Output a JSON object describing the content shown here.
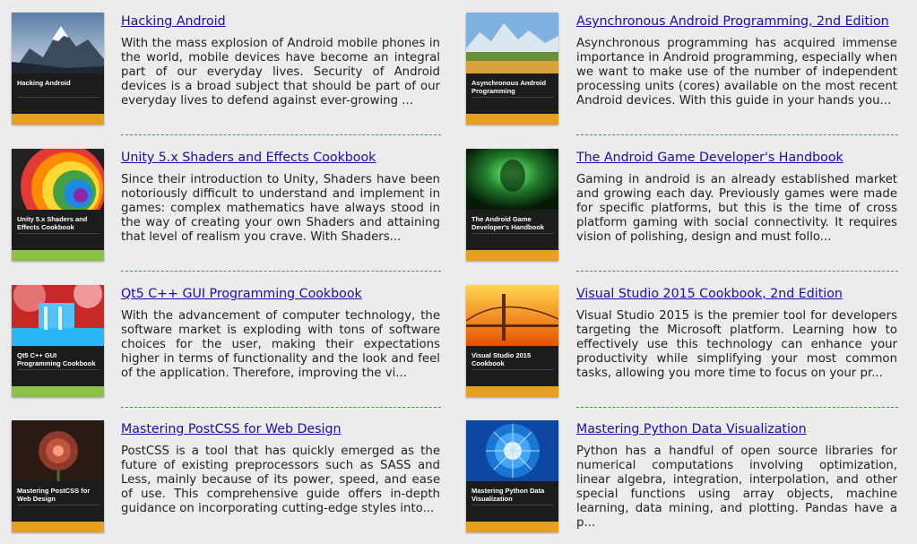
{
  "books": [
    {
      "title": "Hacking Android",
      "description": "With the mass explosion of Android mobile phones in the world, mobile devices have become an integral part of our everyday lives. Security of Android devices is a broad subject that should be part of our everyday lives to defend against ever-growing ...",
      "cover": {
        "title": "Hacking Android",
        "art": "mountain-snow",
        "accent": "#e8a020"
      }
    },
    {
      "title": "Asynchronous Android Programming, 2nd Edition",
      "description": "Asynchronous programming has acquired immense importance in Android programming, especially when we want to make use of the number of independent processing units (cores) available on the most recent Android devices. With this guide in your hands you...",
      "cover": {
        "title": "Asynchronous Android Programming",
        "art": "mountain-lake",
        "accent": "#e8a020"
      }
    },
    {
      "title": "Unity 5.x Shaders and Effects Cookbook",
      "description": "Since their introduction to Unity, Shaders have been notoriously difficult to understand and implement in games: complex mathematics have always stood in the way of creating your own Shaders and attaining that level of realism you crave. With Shaders...",
      "cover": {
        "title": "Unity 5.x Shaders and Effects Cookbook",
        "art": "rainbow-swirl",
        "accent": "#8bc34a"
      }
    },
    {
      "title": "The Android Game Developer's Handbook",
      "description": "Gaming in android is an already established market and growing each day. Previously games were made for specific platforms, but this is the time of cross platform gaming with social connectivity. It requires vision of polishing, design and must follo...",
      "cover": {
        "title": "The Android Game Developer's Handbook",
        "art": "green-glow",
        "accent": "#e8a020"
      }
    },
    {
      "title": "Qt5 C++ GUI Programming Cookbook",
      "description": "With the advancement of computer technology, the software market is exploding with tons of software choices for the user, making their expectations higher in terms of functionality and the look and feel of the application. Therefore, improving the vi...",
      "cover": {
        "title": "Qt5 C++ GUI Programming Cookbook",
        "art": "waterfall-red",
        "accent": "#8bc34a"
      }
    },
    {
      "title": "Visual Studio 2015 Cookbook, 2nd Edition",
      "description": "Visual Studio 2015 is the premier tool for developers targeting the Microsoft platform. Learning how to effectively use this technology can enhance your productivity while simplifying your most common tasks, allowing you more time to focus on your pr...",
      "cover": {
        "title": "Visual Studio 2015 Cookbook",
        "art": "golden-bridge",
        "accent": "#e8a020"
      }
    },
    {
      "title": "Mastering PostCSS for Web Design",
      "description": "PostCSS is a tool that has quickly emerged as the future of existing preprocessors such as SASS and Less, mainly because of its power, speed, and ease of use. This comprehensive guide offers in-depth guidance on incorporating cutting-edge styles into...",
      "cover": {
        "title": "Mastering PostCSS for Web Design",
        "art": "red-flower",
        "accent": "#e8a020"
      }
    },
    {
      "title": "Mastering Python Data Visualization",
      "description": "Python has a handful of open source libraries for numerical computations involving optimization, linear algebra, integration, interpolation, and other special functions using array objects, machine learning, data mining, and plotting. Pandas have a p...",
      "cover": {
        "title": "Mastering Python Data Visualization",
        "art": "blue-dome",
        "accent": "#e8a020"
      }
    }
  ]
}
